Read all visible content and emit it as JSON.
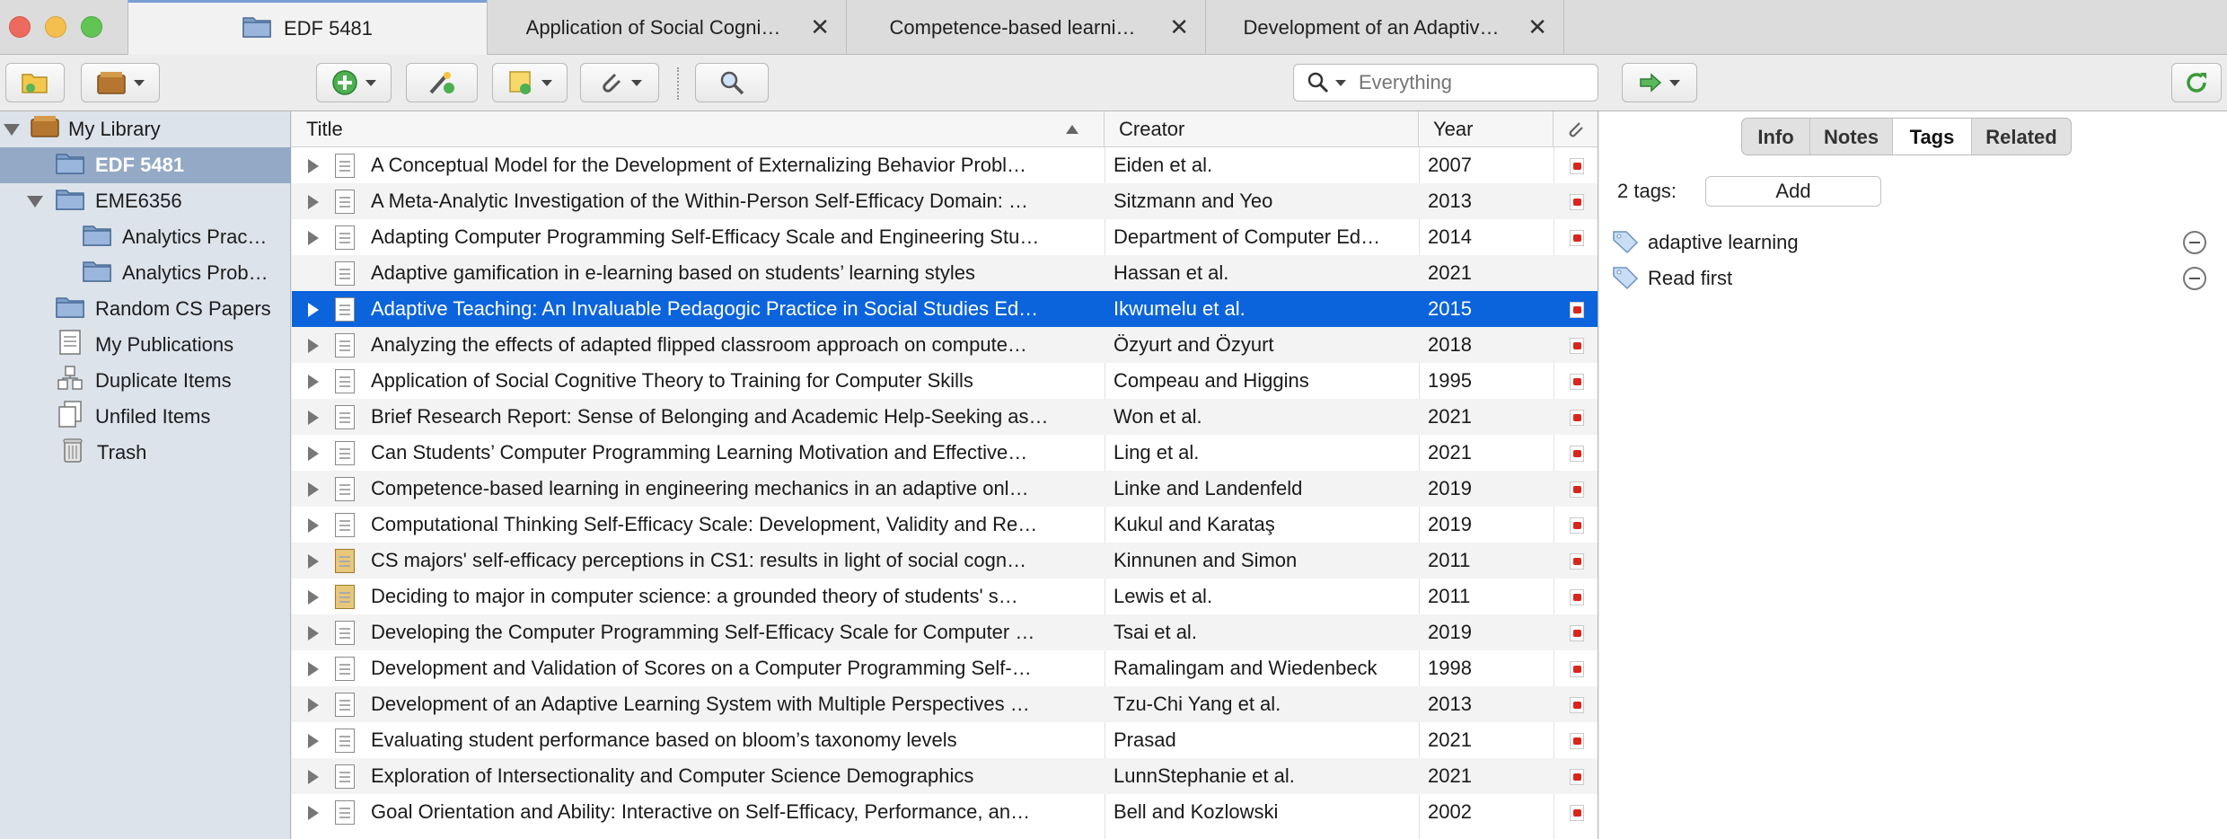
{
  "tabs": [
    {
      "label": "EDF 5481",
      "icon": "folder-icon"
    },
    {
      "label": "Application of Social Cogni…",
      "close": "✕"
    },
    {
      "label": "Competence-based learni…",
      "close": "✕"
    },
    {
      "label": "Development of an Adaptiv…",
      "close": "✕"
    }
  ],
  "search": {
    "placeholder": "Everything"
  },
  "sidebar": {
    "items": [
      {
        "label": "My Library",
        "icon": "library-icon"
      },
      {
        "label": "EDF 5481",
        "icon": "folder-icon"
      },
      {
        "label": "EME6356",
        "icon": "folder-icon"
      },
      {
        "label": "Analytics Prac…",
        "icon": "folder-icon"
      },
      {
        "label": "Analytics Prob…",
        "icon": "folder-icon"
      },
      {
        "label": "Random CS Papers",
        "icon": "folder-icon"
      },
      {
        "label": "My Publications",
        "icon": "document-icon"
      },
      {
        "label": "Duplicate Items",
        "icon": "duplicate-icon"
      },
      {
        "label": "Unfiled Items",
        "icon": "unfiled-icon"
      },
      {
        "label": "Trash",
        "icon": "trash-icon"
      }
    ]
  },
  "table": {
    "columns": {
      "title": "Title",
      "creator": "Creator",
      "year": "Year"
    },
    "rows": [
      {
        "title": "A Conceptual Model for the Development of Externalizing Behavior Probl…",
        "creator": "Eiden et al.",
        "year": "2007"
      },
      {
        "title": "A Meta-Analytic Investigation of the Within-Person Self-Efficacy Domain: …",
        "creator": "Sitzmann and Yeo",
        "year": "2013"
      },
      {
        "title": "Adapting Computer Programming Self-Efficacy Scale and Engineering Stu…",
        "creator": "Department of Computer Ed…",
        "year": "2014"
      },
      {
        "title": "Adaptive gamification in e-learning based on students’ learning styles",
        "creator": "Hassan et al.",
        "year": "2021"
      },
      {
        "title": "Adaptive Teaching: An Invaluable Pedagogic Practice in Social Studies Ed…",
        "creator": "Ikwumelu et al.",
        "year": "2015"
      },
      {
        "title": "Analyzing the effects of adapted flipped classroom approach on compute…",
        "creator": "Özyurt and Özyurt",
        "year": "2018"
      },
      {
        "title": "Application of Social Cognitive Theory to Training for Computer Skills",
        "creator": "Compeau and Higgins",
        "year": "1995"
      },
      {
        "title": "Brief Research Report: Sense of Belonging and Academic Help-Seeking as…",
        "creator": "Won et al.",
        "year": "2021"
      },
      {
        "title": "Can Students’ Computer Programming Learning Motivation and Effective…",
        "creator": "Ling et al.",
        "year": "2021"
      },
      {
        "title": "Competence-based learning in engineering mechanics in an adaptive onl…",
        "creator": "Linke and Landenfeld",
        "year": "2019"
      },
      {
        "title": "Computational Thinking Self-Efficacy Scale: Development, Validity and Re…",
        "creator": "Kukul and Karataş",
        "year": "2019"
      },
      {
        "title": "CS majors' self-efficacy perceptions in CS1: results in light of social cogn…",
        "creator": "Kinnunen and Simon",
        "year": "2011"
      },
      {
        "title": "Deciding to major in computer science: a grounded theory of students' s…",
        "creator": "Lewis et al.",
        "year": "2011"
      },
      {
        "title": "Developing the Computer Programming Self-Efficacy Scale for Computer …",
        "creator": "Tsai et al.",
        "year": "2019"
      },
      {
        "title": "Development and Validation of Scores on a Computer Programming Self-…",
        "creator": "Ramalingam and Wiedenbeck",
        "year": "1998"
      },
      {
        "title": "Development of an Adaptive Learning System with Multiple Perspectives …",
        "creator": "Tzu-Chi Yang et al.",
        "year": "2013"
      },
      {
        "title": "Evaluating student performance based on bloom’s taxonomy levels",
        "creator": "Prasad",
        "year": "2021"
      },
      {
        "title": "Exploration of Intersectionality and Computer Science Demographics",
        "creator": "LunnStephanie et al.",
        "year": "2021"
      },
      {
        "title": "Goal Orientation and Ability: Interactive on Self-Efficacy, Performance, an…",
        "creator": "Bell and Kozlowski",
        "year": "2002"
      }
    ]
  },
  "pane": {
    "tabs": [
      "Info",
      "Notes",
      "Tags",
      "Related"
    ],
    "active_tab": "Tags",
    "tag_count": "2 tags:",
    "add_label": "Add",
    "tags": [
      "adaptive learning",
      "Read first"
    ]
  },
  "colors": {
    "selection": "#0b64dc",
    "sidebar_selected": "#93a9c6",
    "pdf_red": "#d9261c"
  }
}
